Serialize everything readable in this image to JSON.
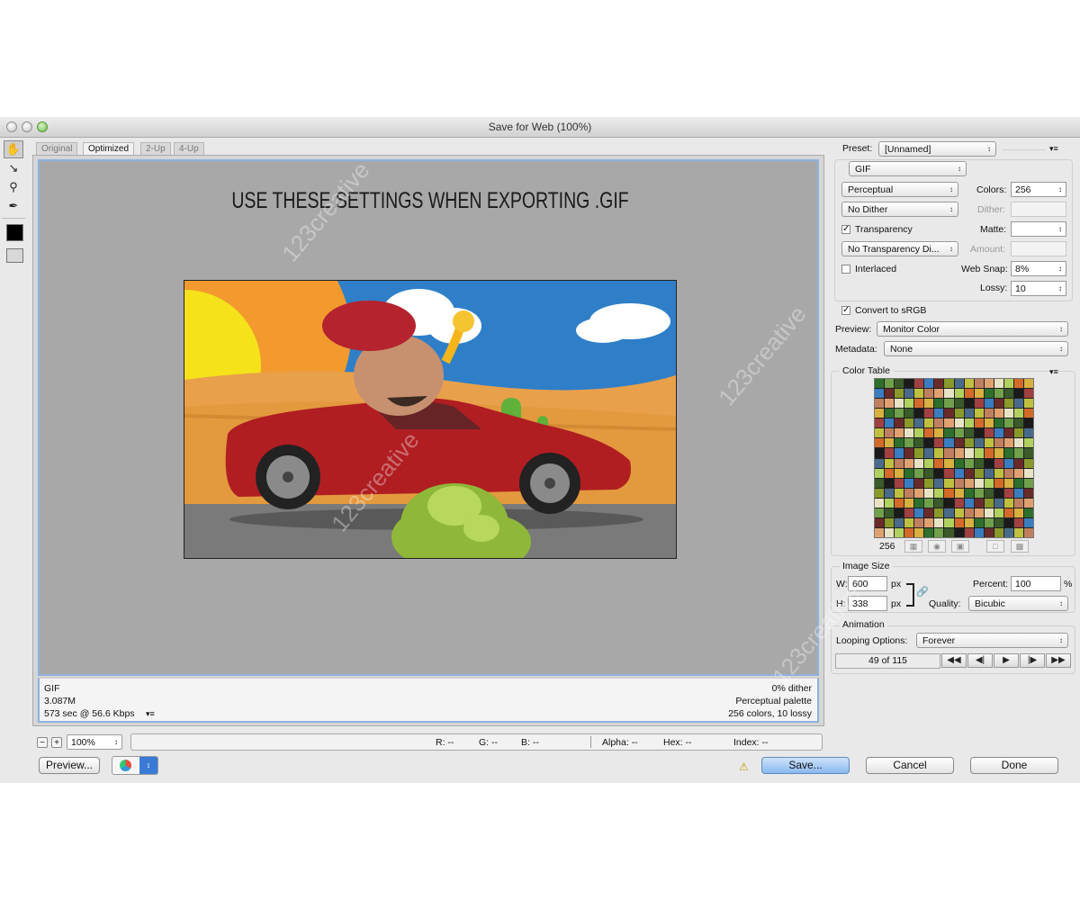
{
  "window": {
    "title": "Save for Web (100%)"
  },
  "tabs": [
    "Original",
    "Optimized",
    "2-Up",
    "4-Up"
  ],
  "active_tab": "Optimized",
  "canvas": {
    "headline": "USE THESE SETTINGS WHEN EXPORTING .GIF"
  },
  "info_left": [
    "GIF",
    "3.087M",
    "573 sec @ 56.6 Kbps"
  ],
  "info_right": [
    "0% dither",
    "Perceptual palette",
    "256 colors, 10 lossy"
  ],
  "zoom": {
    "value": "100%"
  },
  "readout": {
    "r": "R: --",
    "g": "G: --",
    "b": "B: --",
    "alpha": "Alpha: --",
    "hex": "Hex: --",
    "index": "Index: --"
  },
  "buttons": {
    "preview": "Preview...",
    "save": "Save...",
    "cancel": "Cancel",
    "done": "Done"
  },
  "settings": {
    "preset_label": "Preset:",
    "preset_value": "[Unnamed]",
    "format": "GIF",
    "reduction": "Perceptual",
    "colors_label": "Colors:",
    "colors_value": "256",
    "dither_method": "No Dither",
    "dither_label": "Dither:",
    "dither_value": "",
    "transparency_label": "Transparency",
    "transparency_checked": true,
    "matte_label": "Matte:",
    "matte_value": "",
    "transparency_dither": "No Transparency Di...",
    "amount_label": "Amount:",
    "amount_value": "",
    "interlaced_label": "Interlaced",
    "interlaced_checked": false,
    "websnap_label": "Web Snap:",
    "websnap_value": "8%",
    "lossy_label": "Lossy:",
    "lossy_value": "10",
    "convert_label": "Convert to sRGB",
    "convert_checked": true,
    "preview_label": "Preview:",
    "preview_value": "Monitor Color",
    "metadata_label": "Metadata:",
    "metadata_value": "None"
  },
  "color_table": {
    "title": "Color Table",
    "count": "256",
    "colors": [
      "#2e6f2c",
      "#8a9a2a",
      "#d46a2a",
      "#3a7cc0",
      "#e7e3c4",
      "#1a1a1a",
      "#c08060",
      "#70a04a",
      "#4a6a8a",
      "#d8b040",
      "#6a2a2a",
      "#b0d060",
      "#a04040",
      "#e0a070",
      "#3a5a2a",
      "#c0c040"
    ]
  },
  "image_size": {
    "title": "Image Size",
    "w_label": "W:",
    "w_value": "600",
    "h_label": "H:",
    "h_value": "338",
    "unit": "px",
    "percent_label": "Percent:",
    "percent_value": "100",
    "percent_unit": "%",
    "quality_label": "Quality:",
    "quality_value": "Bicubic"
  },
  "animation": {
    "title": "Animation",
    "looping_label": "Looping Options:",
    "looping_value": "Forever",
    "frame": "49 of 115"
  },
  "watermark": "123creative"
}
